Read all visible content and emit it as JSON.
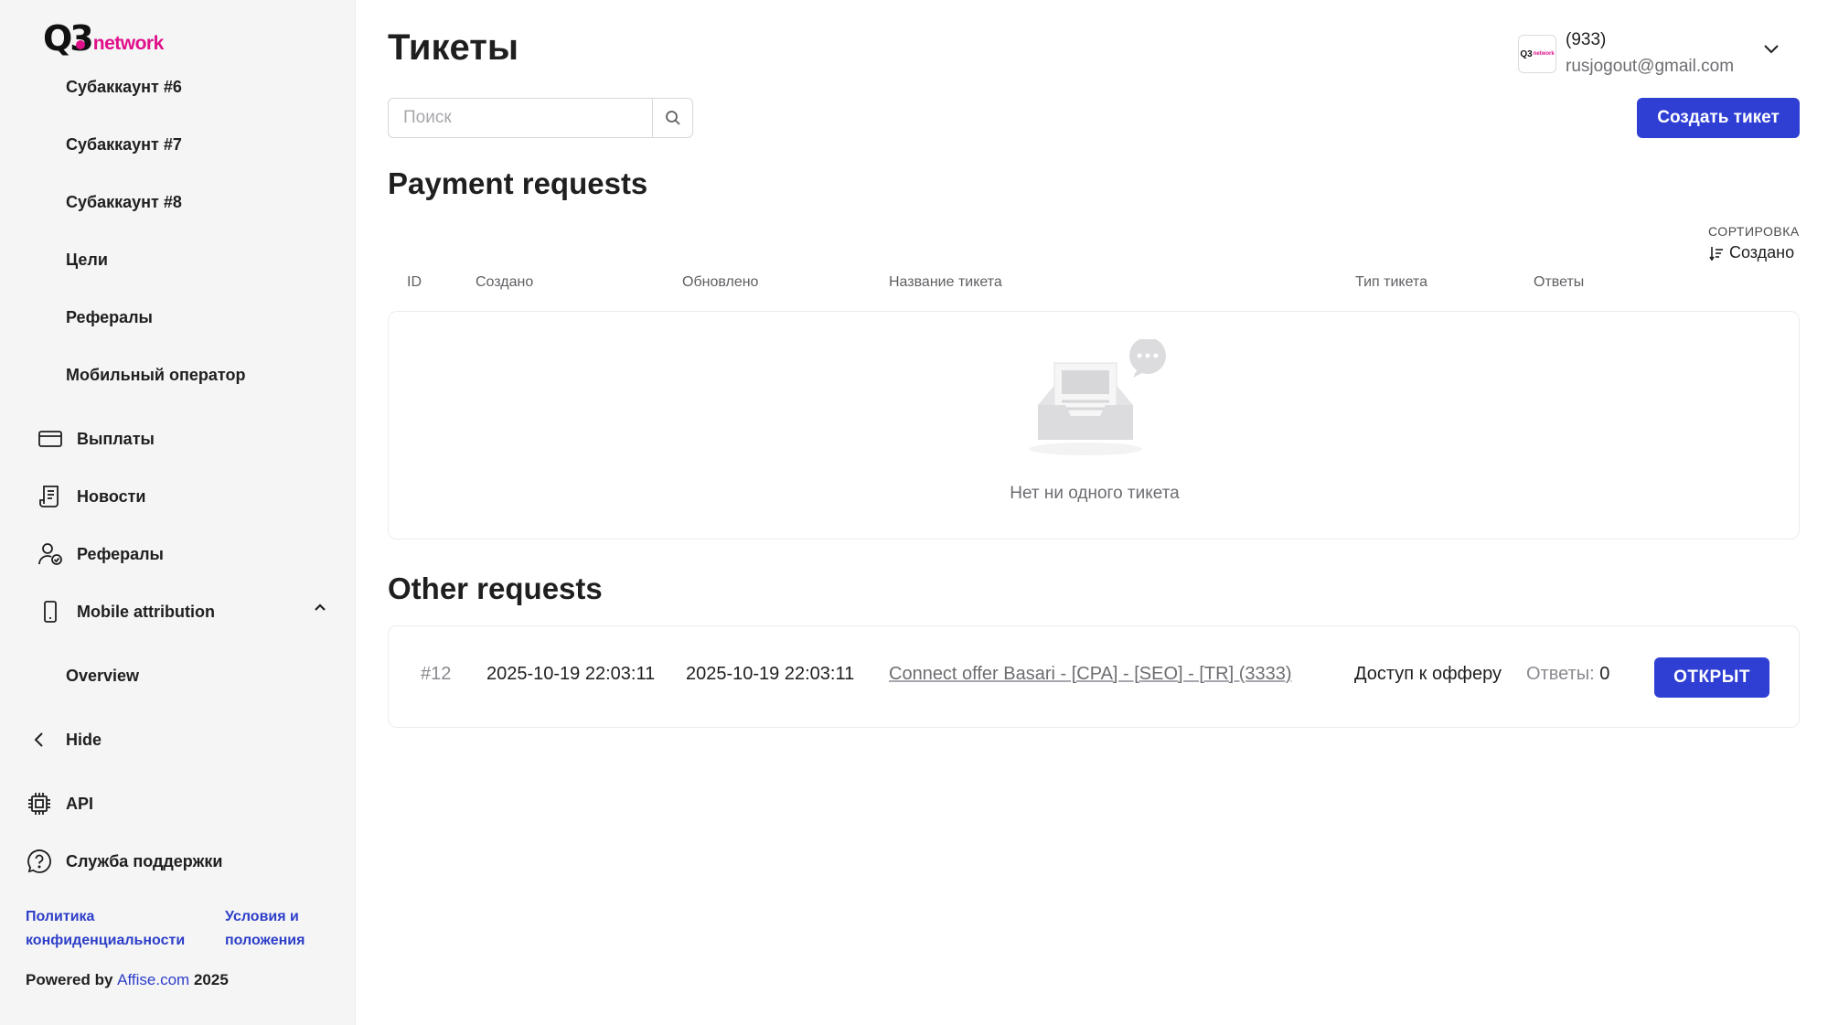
{
  "brand": {
    "logo_mark": "Q3",
    "logo_text": "network",
    "accent": "#e0108a",
    "primary": "#2f3fd4"
  },
  "sidebar": {
    "sub_items": [
      "Субаккаунт #6",
      "Субаккаунт #7",
      "Субаккаунт #8",
      "Цели",
      "Рефералы",
      "Мобильный оператор"
    ],
    "nav": {
      "payouts": {
        "label": "Выплаты",
        "icon": "card-icon"
      },
      "news": {
        "label": "Новости",
        "icon": "news-icon"
      },
      "referrals": {
        "label": "Рефералы",
        "icon": "referrals-icon"
      },
      "mobile_attribution": {
        "label": "Mobile attribution",
        "icon": "phone-icon"
      },
      "overview": {
        "label": "Overview"
      },
      "hide": {
        "label": "Hide",
        "icon": "chevron-left-icon"
      },
      "api": {
        "label": "API",
        "icon": "chip-icon"
      },
      "support": {
        "label": "Служба поддержки",
        "icon": "help-icon"
      }
    },
    "footer": {
      "privacy_line1": "Политика",
      "privacy_line2": "конфиденциальности",
      "terms_line1": "Условия и",
      "terms_line2": "положения",
      "powered_prefix": "Powered by",
      "powered_link": "Affise.com",
      "powered_year": "2025"
    }
  },
  "header": {
    "title": "Тикеты",
    "search_placeholder": "Поиск",
    "user_id": "(933)",
    "user_email": "rusjogout@gmail.com",
    "create_button": "Создать тикет"
  },
  "payment_requests": {
    "title": "Payment requests",
    "sort_label": "СОРТИРОВКА",
    "sort_value": "Создано",
    "columns": [
      "ID",
      "Создано",
      "Обновлено",
      "Название тикета",
      "Тип тикета",
      "Ответы"
    ],
    "empty_text": "Нет ни одного тикета"
  },
  "other_requests": {
    "title": "Other requests",
    "rows": [
      {
        "id": "#12",
        "created": "2025-10-19 22:03:11",
        "updated": "2025-10-19 22:03:11",
        "name": "Connect offer Basari - [CPA] - [SEO] - [TR] (3333)",
        "type": "Доступ к офферу",
        "replies_label": "Ответы:",
        "replies_count": "0",
        "status_button": "ОТКРЫТ"
      }
    ]
  }
}
